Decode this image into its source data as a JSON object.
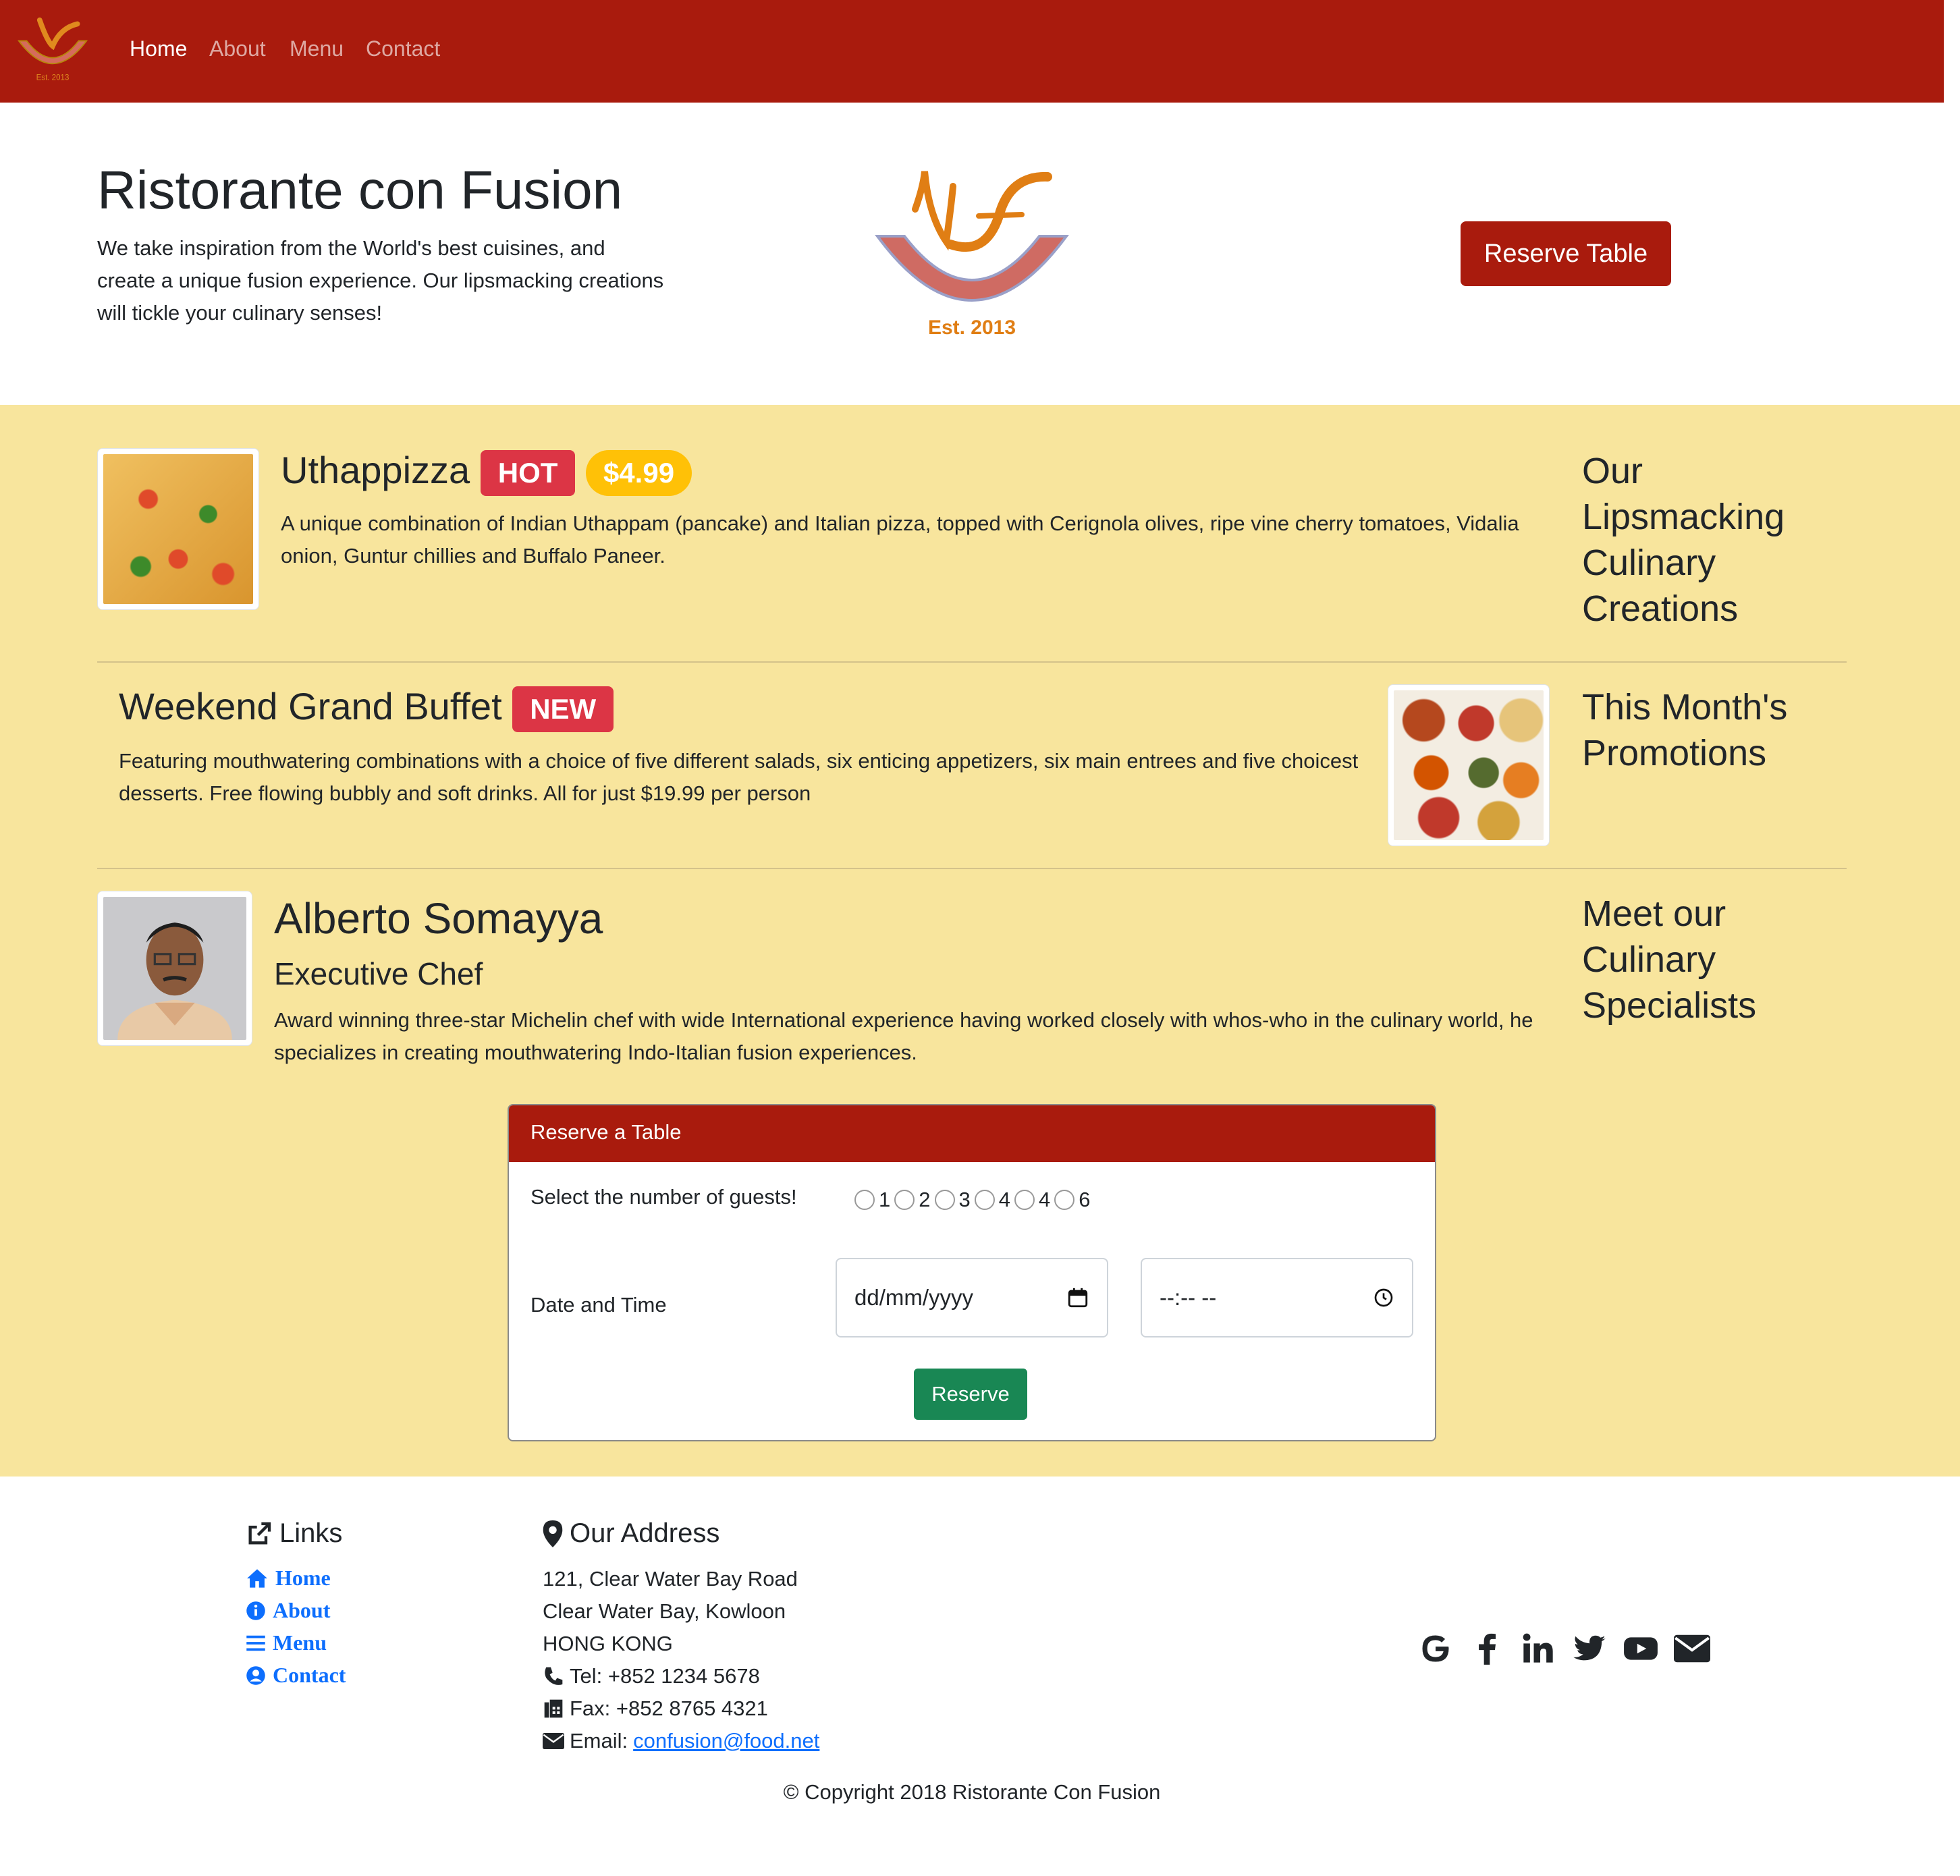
{
  "nav": {
    "links": [
      "Home",
      "About",
      "Menu",
      "Contact"
    ],
    "active": "Home"
  },
  "logo": {
    "text": "Ristorante con Fusion",
    "est": "Est. 2013"
  },
  "jumbotron": {
    "title": "Ristorante con Fusion",
    "text": "We take inspiration from the World's best cuisines, and create a unique fusion experience. Our lipsmacking creations will tickle your culinary senses!",
    "button": "Reserve Table"
  },
  "sections": {
    "dish": {
      "name": "Uthappizza",
      "badge": "HOT",
      "price": "$4.99",
      "description": "A unique combination of Indian Uthappam (pancake) and Italian pizza, topped with Cerignola olives, ripe vine cherry tomatoes, Vidalia onion, Guntur chillies and Buffalo Paneer.",
      "side_title": "Our Lipsmacking Culinary Creations"
    },
    "promotion": {
      "name": "Weekend Grand Buffet",
      "badge": "NEW",
      "description": "Featuring mouthwatering combinations with a choice of five different salads, six enticing appetizers, six main entrees and five choicest desserts. Free flowing bubbly and soft drinks. All for just $19.99 per person",
      "side_title": "This Month's Promotions"
    },
    "leader": {
      "name": "Alberto Somayya",
      "role": "Executive Chef",
      "description": "Award winning three-star Michelin chef with wide International experience having worked closely with whos-who in the culinary world, he specializes in creating mouthwatering Indo-Italian fusion experiences.",
      "side_title": "Meet our Culinary Specialists"
    }
  },
  "reservation": {
    "title": "Reserve a Table",
    "guests_label": "Select the number of guests!",
    "guest_options": [
      "1",
      "2",
      "3",
      "4",
      "4",
      "6"
    ],
    "datetime_label": "Date and Time",
    "date_placeholder": "dd/mm/yyyy",
    "time_placeholder": "--:-- --",
    "submit": "Reserve"
  },
  "footer": {
    "links_title": "Links",
    "links": [
      "Home",
      "About",
      "Menu",
      "Contact"
    ],
    "address_title": "Our Address",
    "address_lines": [
      "121, Clear Water Bay Road",
      "Clear Water Bay, Kowloon",
      "HONG KONG"
    ],
    "tel": "Tel: +852 1234 5678",
    "fax": "Fax: +852 8765 4321",
    "email_label": "Email: ",
    "email": "confusion@food.net",
    "social_icons": [
      "google-icon",
      "facebook-icon",
      "linkedin-icon",
      "twitter-icon",
      "youtube-icon",
      "envelope-icon"
    ],
    "copyright": "© Copyright 2018 Ristorante Con Fusion"
  },
  "colors": {
    "brand": "#a91b0d",
    "section_bg": "#f8e59d",
    "badge_red": "#dc3545",
    "badge_yellow": "#ffc107",
    "success": "#198754",
    "link": "#0d6efd"
  }
}
